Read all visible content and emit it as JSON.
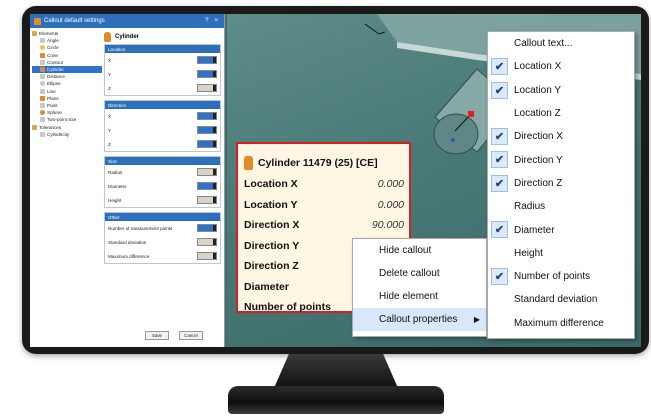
{
  "dialog": {
    "title": "Callout default settings",
    "title_controls": [
      "?",
      "×"
    ],
    "tree": [
      "Elements",
      "Angle",
      "Circle",
      "Cone",
      "Contour",
      "Cylinder",
      "Distance",
      "Ellipse",
      "Line",
      "Plane",
      "Point",
      "Sphere",
      "Two-point size",
      "Tolerances",
      "Cylindricity"
    ],
    "selected_tree_item": "Cylinder",
    "heading": "Cylinder",
    "groups": [
      {
        "name": "Location",
        "rows": [
          {
            "label": "X",
            "on": true
          },
          {
            "label": "Y",
            "on": true
          },
          {
            "label": "Z",
            "on": false
          }
        ]
      },
      {
        "name": "Direction",
        "rows": [
          {
            "label": "X",
            "on": true
          },
          {
            "label": "Y",
            "on": true
          },
          {
            "label": "Z",
            "on": true
          }
        ]
      },
      {
        "name": "Size",
        "rows": [
          {
            "label": "Radius",
            "on": false
          },
          {
            "label": "Diameter",
            "on": true
          },
          {
            "label": "Height",
            "on": false
          }
        ]
      },
      {
        "name": "Other",
        "rows": [
          {
            "label": "Number of measurement points",
            "on": true
          },
          {
            "label": "Standard deviation",
            "on": false
          },
          {
            "label": "Maximum difference",
            "on": false
          }
        ]
      }
    ],
    "save_label": "Save",
    "cancel_label": "Cancel"
  },
  "callout": {
    "title": "Cylinder 11479 (25) [CE]",
    "rows": [
      {
        "label": "Location X",
        "value": "0.000"
      },
      {
        "label": "Location Y",
        "value": "0.000"
      },
      {
        "label": "Direction X",
        "value": "90.000"
      },
      {
        "label": "Direction Y",
        "value": "0.000"
      },
      {
        "label": "Direction Z",
        "value": ""
      },
      {
        "label": "Diameter",
        "value": ""
      },
      {
        "label": "Number of points",
        "value": ""
      }
    ]
  },
  "context_menu": {
    "items": [
      "Hide callout",
      "Delete callout",
      "Hide element",
      "Callout properties"
    ],
    "highlighted": "Callout properties"
  },
  "submenu": {
    "items": [
      {
        "label": "Callout text...",
        "checked": false
      },
      {
        "label": "Location X",
        "checked": true
      },
      {
        "label": "Location Y",
        "checked": true
      },
      {
        "label": "Location Z",
        "checked": false
      },
      {
        "label": "Direction X",
        "checked": true
      },
      {
        "label": "Direction Y",
        "checked": true
      },
      {
        "label": "Direction Z",
        "checked": true
      },
      {
        "label": "Radius",
        "checked": false
      },
      {
        "label": "Diameter",
        "checked": true
      },
      {
        "label": "Height",
        "checked": false
      },
      {
        "label": "Number of points",
        "checked": true
      },
      {
        "label": "Standard deviation",
        "checked": false
      },
      {
        "label": "Maximum difference",
        "checked": false
      }
    ]
  },
  "colors": {
    "accent": "#2e6fbc",
    "callout_border": "#d62020",
    "callout_bg": "#fff6e3",
    "viewport": "#4b7b78"
  }
}
